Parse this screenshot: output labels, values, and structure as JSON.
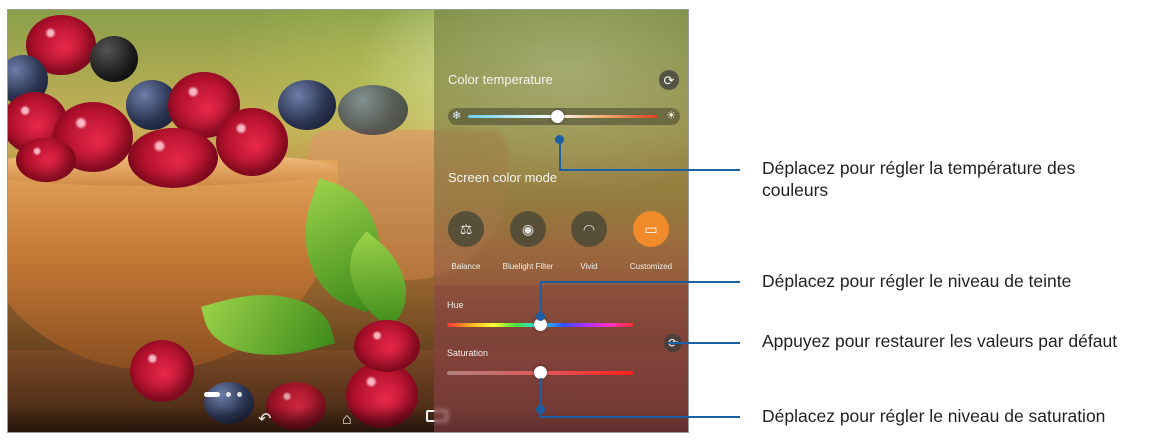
{
  "panel": {
    "color_temperature": {
      "title": "Color temperature",
      "reset_icon": "refresh-icon",
      "cool_icon": "snowflake-icon",
      "warm_icon": "sun-icon",
      "value_fraction": 0.47
    },
    "screen_color_mode": {
      "title": "Screen color mode",
      "modes": [
        {
          "label": "Balance",
          "icon": "scale-icon",
          "active": false
        },
        {
          "label": "Bluelight Filter",
          "icon": "eye-shield-icon",
          "active": false
        },
        {
          "label": "Vivid",
          "icon": "rainbow-icon",
          "active": false
        },
        {
          "label": "Customized",
          "icon": "custom-display-icon",
          "active": true
        }
      ],
      "active_color": "#f08a2a"
    },
    "hue": {
      "label": "Hue",
      "value_fraction": 0.5
    },
    "saturation": {
      "label": "Saturation",
      "value_fraction": 0.5
    },
    "reset_defaults_icon": "refresh-icon"
  },
  "navigation": {
    "back_icon": "back-icon",
    "home_icon": "home-icon",
    "recents_icon": "recents-icon"
  },
  "callouts": {
    "temperature": "Déplacez pour régler la température des couleurs",
    "hue": "Déplacez pour régler le niveau de teinte",
    "reset": "Appuyez pour restaurer les valeurs par défaut",
    "saturation": "Déplacez pour régler le niveau de saturation"
  },
  "colors": {
    "callout_line": "#1d5fa5",
    "callout_text": "#231f20"
  }
}
